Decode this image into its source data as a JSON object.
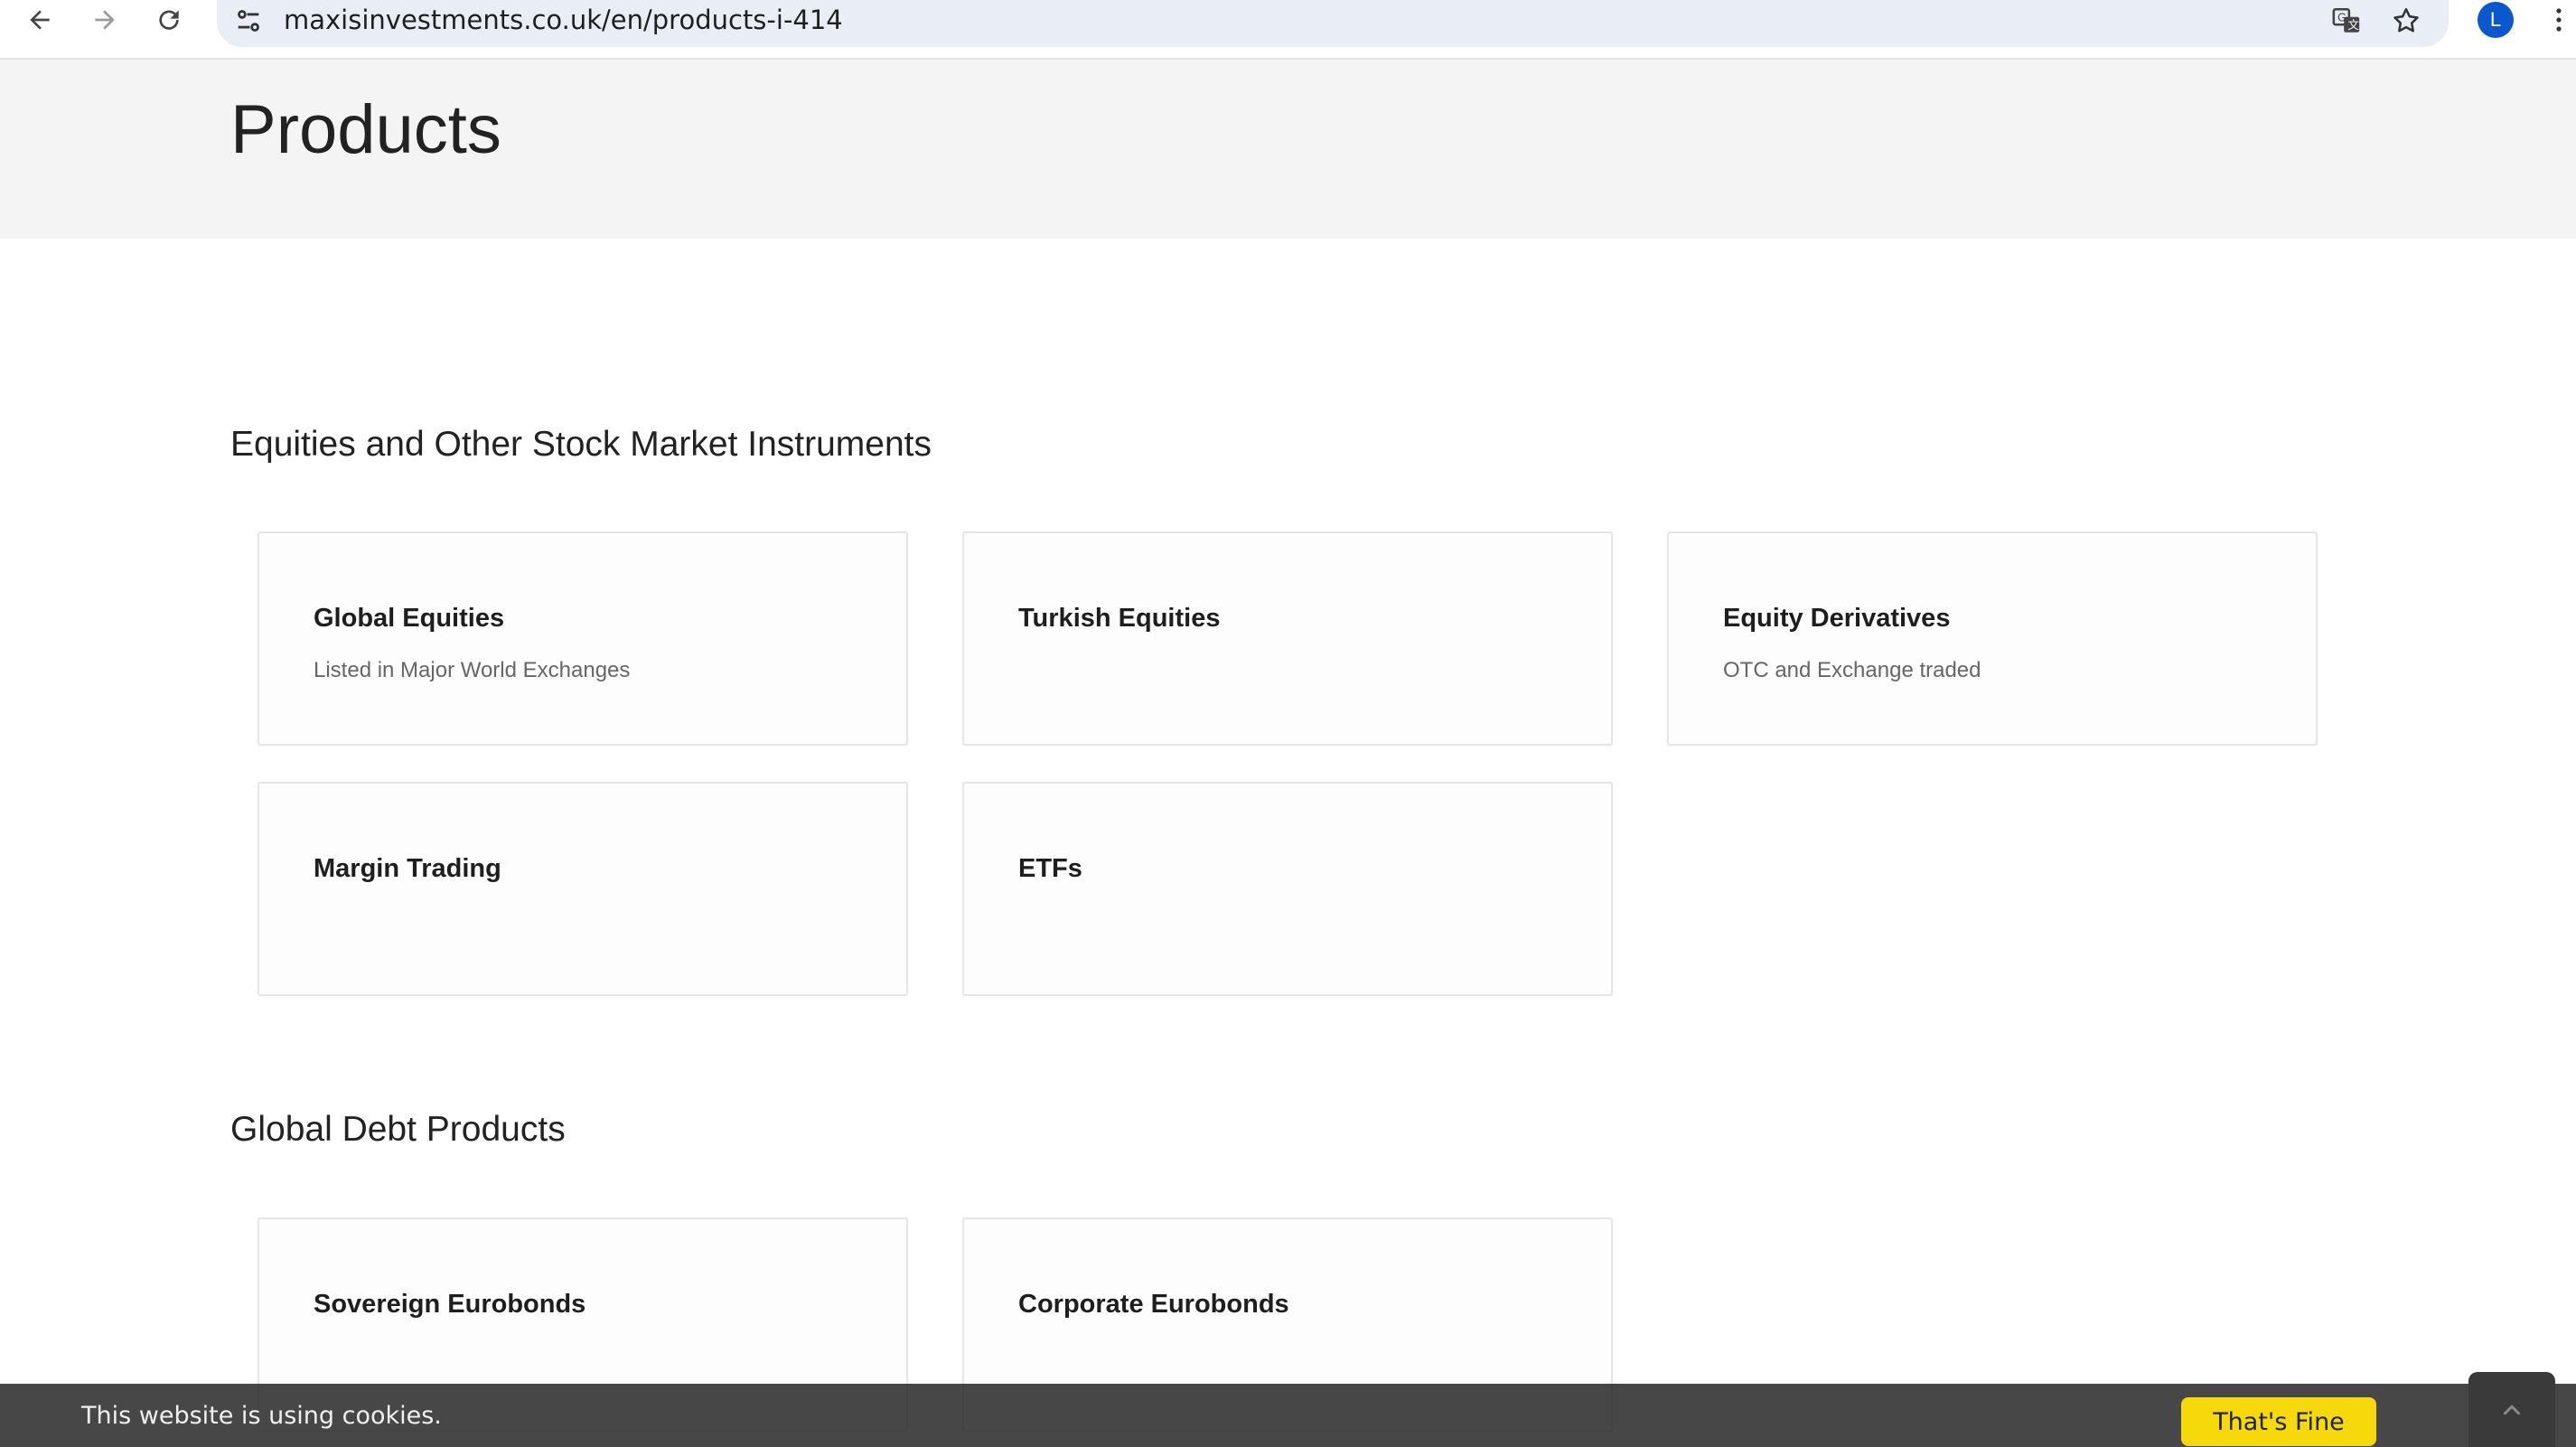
{
  "browser": {
    "url": "maxisinvestments.co.uk/en/products-i-414",
    "profile_initial": "L",
    "icons": {
      "back": "arrow-left-icon",
      "forward": "arrow-right-icon",
      "reload": "reload-icon",
      "site_info": "tune-icon",
      "translate": "translate-icon",
      "bookmark": "star-icon",
      "menu": "more-vert-icon"
    }
  },
  "page": {
    "title": "Products"
  },
  "sections": [
    {
      "title": "Equities and Other Stock Market Instruments",
      "cards": [
        {
          "title": "Global Equities",
          "subtitle": "Listed in Major World Exchanges"
        },
        {
          "title": "Turkish Equities",
          "subtitle": ""
        },
        {
          "title": "Equity Derivatives",
          "subtitle": "OTC and Exchange traded"
        },
        {
          "title": "Margin Trading",
          "subtitle": ""
        },
        {
          "title": "ETFs",
          "subtitle": ""
        }
      ]
    },
    {
      "title": "Global Debt Products",
      "cards": [
        {
          "title": "Sovereign Eurobonds",
          "subtitle": ""
        },
        {
          "title": "Corporate Eurobonds",
          "subtitle": ""
        }
      ]
    }
  ],
  "cookie_bar": {
    "message": "This website is using cookies.",
    "accept_label": "That's Fine"
  },
  "colors": {
    "accent_button": "#f5d90a",
    "profile_avatar": "#0b57d0",
    "header_band": "#f4f4f4"
  }
}
